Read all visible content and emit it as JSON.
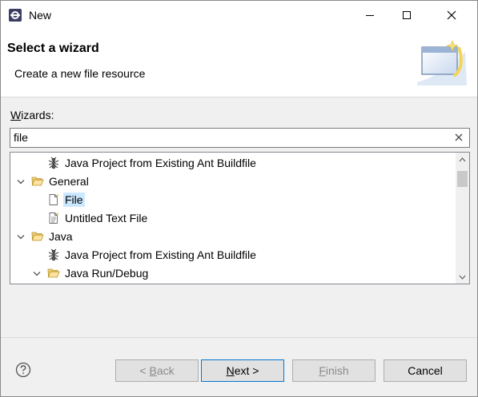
{
  "window": {
    "title": "New",
    "icons": {
      "app": "eclipse-icon",
      "minimize": "minimize-icon",
      "maximize": "maximize-icon",
      "close": "close-icon"
    }
  },
  "header": {
    "title": "Select a wizard",
    "description": "Create a new file resource",
    "graphic": "wizard-banner-icon"
  },
  "wizards": {
    "label_prefix": "W",
    "label_rest": "izards:",
    "filter_value": "file",
    "clear_icon": "clear-icon"
  },
  "tree": {
    "items": [
      {
        "label": "Java Project from Existing Ant Buildfile",
        "icon": "ant-icon",
        "expanded": null,
        "level": 1,
        "selected": false
      },
      {
        "label": "General",
        "icon": "folder-open-icon",
        "expanded": true,
        "level": 0,
        "selected": false
      },
      {
        "label": "File",
        "icon": "new-file-icon",
        "expanded": null,
        "level": 1,
        "selected": true
      },
      {
        "label": "Untitled Text File",
        "icon": "text-file-icon",
        "expanded": null,
        "level": 1,
        "selected": false
      },
      {
        "label": "Java",
        "icon": "folder-open-icon",
        "expanded": true,
        "level": 0,
        "selected": false
      },
      {
        "label": "Java Project from Existing Ant Buildfile",
        "icon": "ant-icon",
        "expanded": null,
        "level": 1,
        "selected": false
      },
      {
        "label": "Java Run/Debug",
        "icon": "folder-open-icon",
        "expanded": true,
        "level": 1,
        "selected": false
      }
    ]
  },
  "footer": {
    "help_icon": "help-icon",
    "back_label": "< Back",
    "back_mnemonic": "B",
    "next_label": "Next >",
    "next_mnemonic": "N",
    "finish_label": "Finish",
    "finish_mnemonic": "F",
    "cancel_label": "Cancel"
  }
}
